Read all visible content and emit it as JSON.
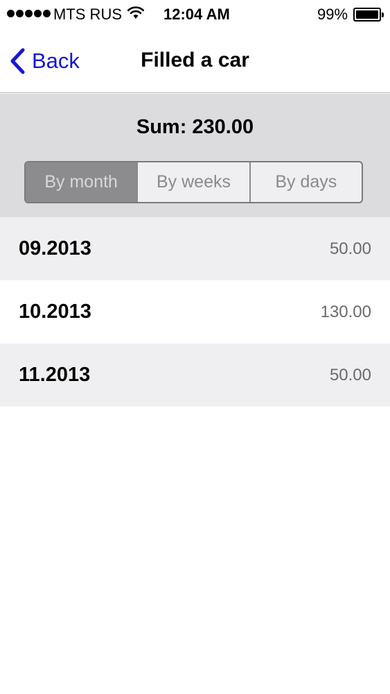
{
  "status_bar": {
    "carrier": "MTS RUS",
    "time": "12:04 AM",
    "battery": "99%"
  },
  "nav": {
    "back_label": "Back",
    "title": "Filled a car"
  },
  "summary": {
    "sum_text": "Sum: 230.00"
  },
  "segments": [
    {
      "label": "By month",
      "selected": true
    },
    {
      "label": "By weeks",
      "selected": false
    },
    {
      "label": "By days",
      "selected": false
    }
  ],
  "rows": [
    {
      "label": "09.2013",
      "value": "50.00"
    },
    {
      "label": "10.2013",
      "value": "130.00"
    },
    {
      "label": "11.2013",
      "value": "50.00"
    }
  ],
  "colors": {
    "accent": "#1515d8",
    "panel": "#dcdcdf",
    "segment_active": "#8c8c8f"
  }
}
